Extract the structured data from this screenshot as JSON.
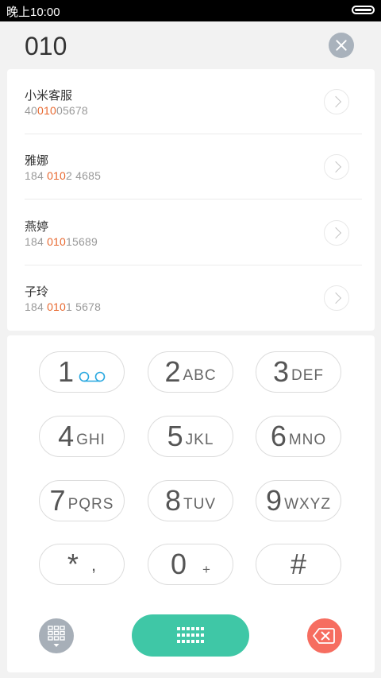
{
  "status_bar": {
    "time": "晚上10:00"
  },
  "dialer": {
    "input_value": "010"
  },
  "results": [
    {
      "name": "小米客服",
      "number_pre": "40",
      "number_match": "010",
      "number_post": "05678"
    },
    {
      "name": "雅娜",
      "number_pre": "184 ",
      "number_match": "010",
      "number_post": "2 4685"
    },
    {
      "name": "燕婷",
      "number_pre": "184 ",
      "number_match": "010",
      "number_post": "15689"
    },
    {
      "name": "子玲",
      "number_pre": "184 ",
      "number_match": "010",
      "number_post": "1 5678"
    }
  ],
  "keypad": {
    "keys": [
      {
        "digit": "1",
        "letters": ""
      },
      {
        "digit": "2",
        "letters": "ABC"
      },
      {
        "digit": "3",
        "letters": "DEF"
      },
      {
        "digit": "4",
        "letters": "GHI"
      },
      {
        "digit": "5",
        "letters": "JKL"
      },
      {
        "digit": "6",
        "letters": "MNO"
      },
      {
        "digit": "7",
        "letters": "PQRS"
      },
      {
        "digit": "8",
        "letters": "TUV"
      },
      {
        "digit": "9",
        "letters": "WXYZ"
      },
      {
        "digit": "*",
        "letters": ","
      },
      {
        "digit": "0",
        "letters": "+"
      },
      {
        "digit": "#",
        "letters": ""
      }
    ]
  },
  "icons": {
    "voicemail": "voicemail-icon",
    "clear": "close-icon",
    "keypad_toggle": "keypad-grid-icon",
    "call": "keypad-dots-icon",
    "delete": "backspace-icon",
    "contact_detail": "chevron-right-icon"
  },
  "colors": {
    "match_highlight": "#e8682f",
    "call_button": "#3fc7a6",
    "delete_button": "#f66d60",
    "voicemail": "#29a8e0"
  }
}
